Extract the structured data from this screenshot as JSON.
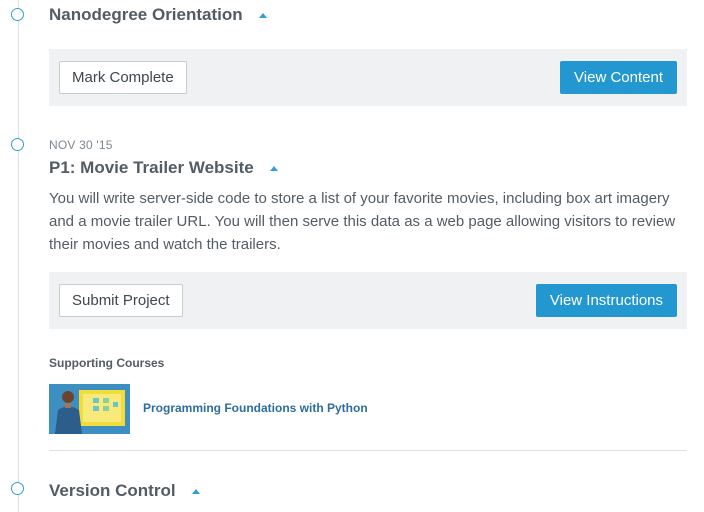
{
  "sections": [
    {
      "title": "Nanodegree Orientation",
      "secondary_button": "Mark Complete",
      "primary_button": "View Content"
    },
    {
      "date": "NOV 30 '15",
      "title": "P1: Movie Trailer Website",
      "description": "You will write server-side code to store a list of your favorite movies, including box art imagery and a movie trailer URL. You will then serve this data as a web page allowing visitors to review their movies and watch the trailers.",
      "secondary_button": "Submit Project",
      "primary_button": "View Instructions",
      "supporting_label": "Supporting Courses",
      "course_link": "Programming Foundations with Python"
    },
    {
      "title": "Version Control"
    }
  ],
  "colors": {
    "accent": "#2397cf",
    "panel": "#f0f1f2",
    "text": "#525c65",
    "link": "#2e6d9e"
  },
  "icons": {
    "section_toggle": "caret-up-icon",
    "timeline_marker": "timeline-circle-icon"
  }
}
